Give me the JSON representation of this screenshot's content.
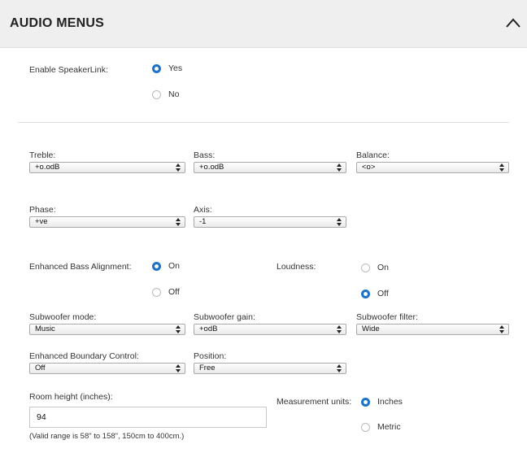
{
  "header": {
    "title": "AUDIO MENUS"
  },
  "speakerlink": {
    "label": "Enable SpeakerLink:",
    "options": [
      "Yes",
      "No"
    ],
    "selected": "Yes"
  },
  "treble": {
    "label": "Treble:",
    "value": "+o.odB"
  },
  "bass": {
    "label": "Bass:",
    "value": "+o.odB"
  },
  "balance": {
    "label": "Balance:",
    "value": "<o>"
  },
  "phase": {
    "label": "Phase:",
    "value": "+ve"
  },
  "axis": {
    "label": "Axis:",
    "value": "-1"
  },
  "eba": {
    "label": "Enhanced Bass Alignment:",
    "options": [
      "On",
      "Off"
    ],
    "selected": "On"
  },
  "loudness": {
    "label": "Loudness:",
    "options": [
      "On",
      "Off"
    ],
    "selected": "Off"
  },
  "sub_mode": {
    "label": "Subwoofer mode:",
    "value": "Music"
  },
  "sub_gain": {
    "label": "Subwoofer gain:",
    "value": "+odB"
  },
  "sub_filter": {
    "label": "Subwoofer filter:",
    "value": "Wide"
  },
  "ebc": {
    "label": "Enhanced Boundary Control:",
    "value": "Off"
  },
  "position": {
    "label": "Position:",
    "value": "Free"
  },
  "room_height": {
    "label": "Room height (inches):",
    "value": "94",
    "hint": "(Valid range is 58\" to 158\", 150cm to 400cm.)"
  },
  "units": {
    "label": "Measurement units:",
    "options": [
      "Inches",
      "Metric"
    ],
    "selected": "Inches"
  },
  "colors": {
    "accent": "#1c72c9",
    "header_bg": "#efefef"
  }
}
